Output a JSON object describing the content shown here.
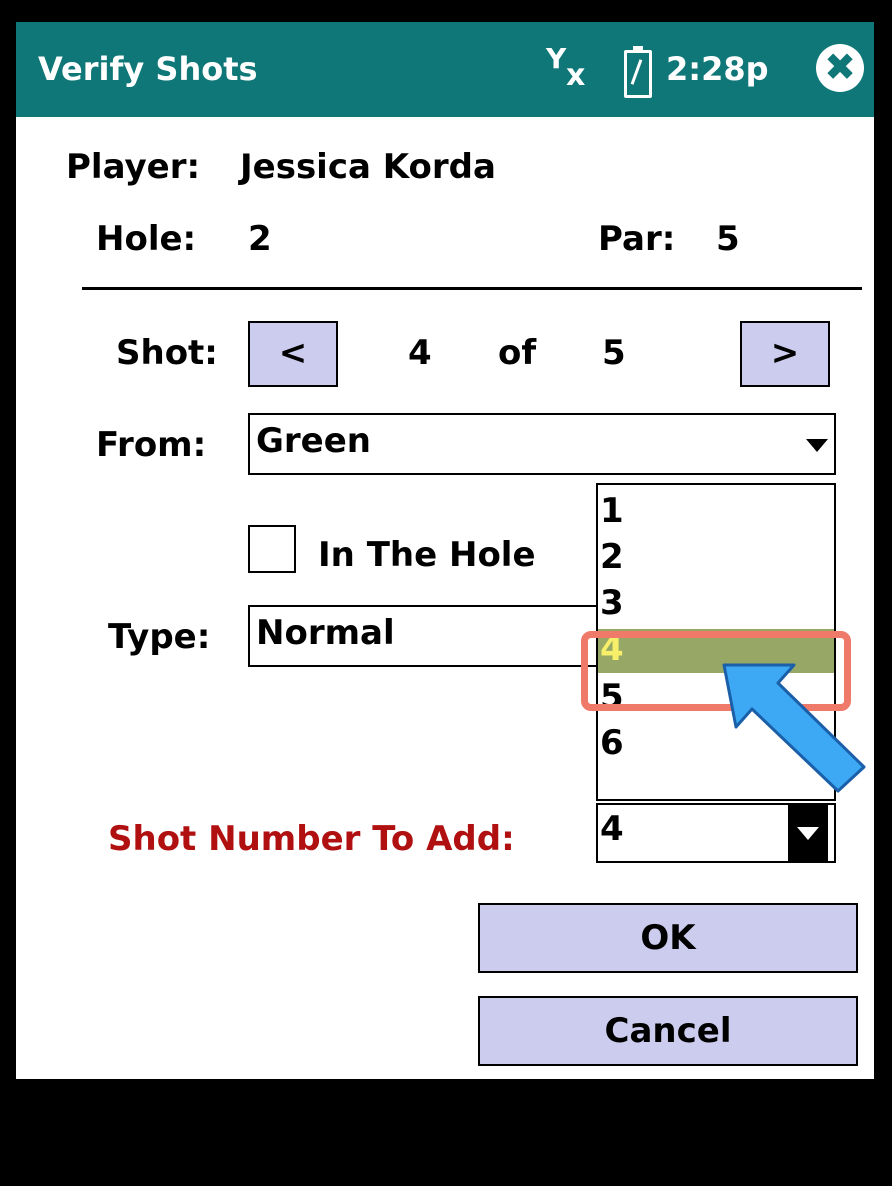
{
  "titlebar": {
    "title": "Verify Shots",
    "time": "2:28p",
    "signal_glyph": "Y",
    "signal_x": "x",
    "close_glyph": "✖"
  },
  "player": {
    "label": "Player:",
    "value": "Jessica Korda"
  },
  "hole": {
    "label": "Hole:",
    "value": "2"
  },
  "par": {
    "label": "Par:",
    "value": "5"
  },
  "shot": {
    "label": "Shot:",
    "prev": "<",
    "current": "4",
    "of": "of",
    "total": "5",
    "next": ">"
  },
  "from": {
    "label": "From:",
    "value": "Green"
  },
  "in_the_hole": {
    "label": "In The Hole",
    "checked": false
  },
  "type": {
    "label": "Type:",
    "value": "Normal"
  },
  "dropdown": {
    "options": [
      "1",
      "2",
      "3",
      "4",
      "5",
      "6"
    ],
    "selected": "4"
  },
  "shot_number_to_add": {
    "label": "Shot Number To Add:",
    "value": "4"
  },
  "buttons": {
    "ok": "OK",
    "cancel": "Cancel"
  },
  "colors": {
    "titlebar": "#0f7777",
    "button_bg": "#ccccee",
    "label_red": "#b01010",
    "selected_bg": "#97a866",
    "selected_text": "#f7ef6a",
    "highlight": "#f07a6a",
    "pointer": "#3da9f5"
  }
}
